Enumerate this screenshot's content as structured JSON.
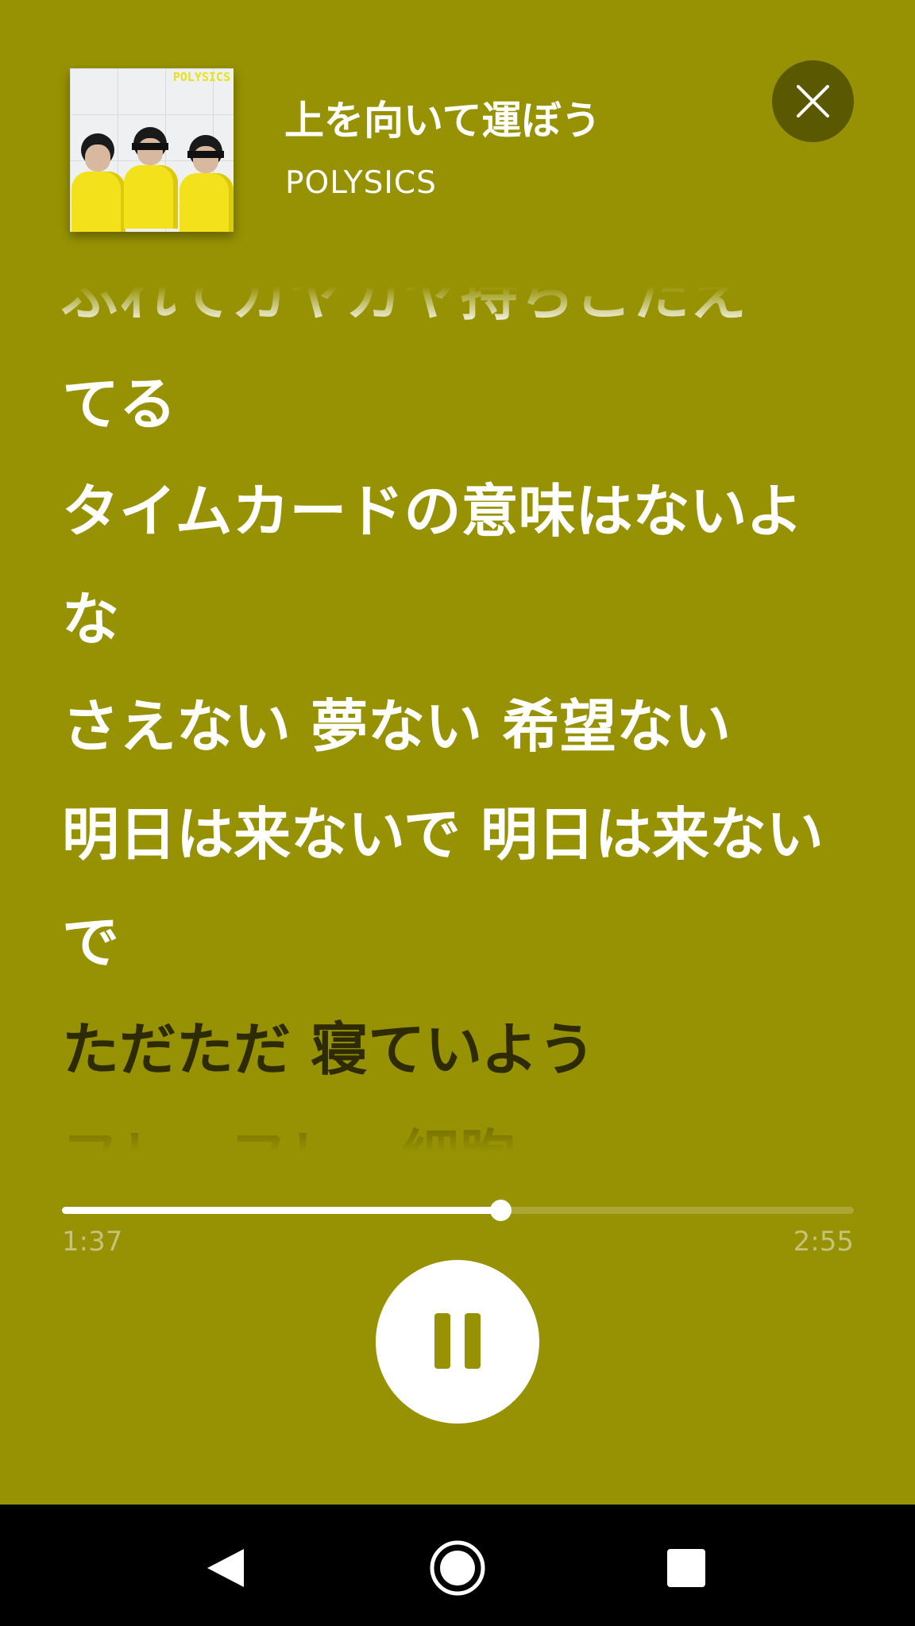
{
  "player": {
    "song_title": "上を向いて運ぼう",
    "artist": "POLYSICS",
    "album_logo": "POLYSICS",
    "close_icon": "close-icon"
  },
  "lyrics": {
    "lines": [
      "ぶれてガヤガヤ持ちこたえ",
      "てる",
      "タイムカードの意味はないよ",
      "な",
      "さえない 夢ない 希望ない",
      "明日は来ないで 明日は来ない",
      "で",
      "ただただ 寝ていよう",
      "フレーフレー細胞"
    ],
    "current_line_index": 7
  },
  "progress": {
    "elapsed": "1:37",
    "total": "2:55",
    "fraction": 0.554
  },
  "controls": {
    "pause_icon": "pause-icon"
  },
  "nav": {
    "back_icon": "back-triangle-icon",
    "home_icon": "home-circle-icon",
    "recents_icon": "recents-square-icon"
  },
  "colors": {
    "background": "#979203",
    "close_button_bg": "#5b5802",
    "active_lyric": "#2e2b02",
    "lyric_text": "#ffffff",
    "time_text": "#c6c27a",
    "nav_bar": "#000000"
  }
}
